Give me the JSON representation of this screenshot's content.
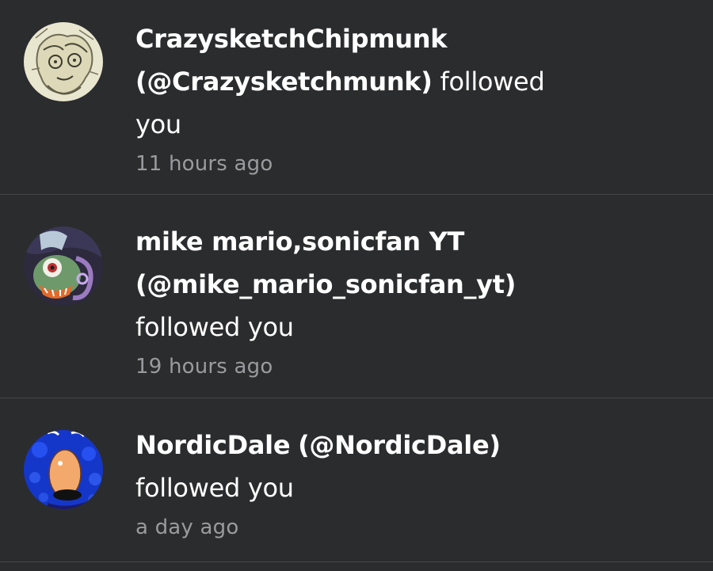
{
  "notifications": [
    {
      "avatar_icon": "sketch-avatar",
      "name": "CrazysketchChipmunk",
      "handle": "(@Crazysketchmunk)",
      "action_inline": "followed",
      "action_next": "you",
      "time": "11 hours ago"
    },
    {
      "avatar_icon": "cartoon-avatar",
      "name": "mike mario,sonicfan YT",
      "handle": "(@mike_mario_sonicfan_yt)",
      "action": "followed you",
      "time": "19 hours ago"
    },
    {
      "avatar_icon": "blue-cartoon-avatar",
      "name": "NordicDale",
      "handle": "(@NordicDale)",
      "action": "followed you",
      "time": "a day ago"
    }
  ],
  "colors": {
    "background": "#2b2c2e",
    "divider": "#46474a",
    "text": "#ffffff",
    "muted": "#9a9b9e"
  }
}
